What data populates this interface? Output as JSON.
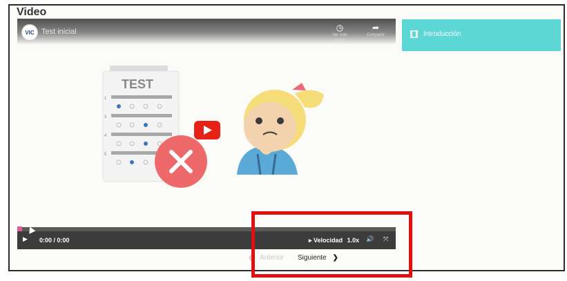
{
  "page": {
    "title": "Video"
  },
  "video": {
    "channel_logo": "VIC",
    "name": "Test inicial",
    "watch_later_label": "Ver más tarde",
    "share_label": "Compartir",
    "thumbnail_text": "TEST",
    "question_numbers": [
      "1",
      "3",
      "4",
      "5"
    ]
  },
  "player": {
    "time": "0:00 / 0:00",
    "speed_label": "Velocidad",
    "speed_value": "1.0x",
    "progress": 0
  },
  "sidebar": {
    "items": [
      {
        "label": "Introducción",
        "icon": "film-icon"
      }
    ]
  },
  "nav": {
    "prev_label": "Anterior",
    "next_label": "Siguiente"
  },
  "colors": {
    "accent": "#5dd6d6",
    "progress": "#e05a9c",
    "highlight": "#e01010"
  }
}
